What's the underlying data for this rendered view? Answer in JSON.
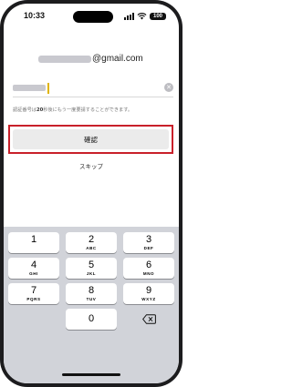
{
  "status_bar": {
    "time": "10:33",
    "battery": "100"
  },
  "account": {
    "email_domain": "@gmail.com"
  },
  "code_input": {
    "clear_icon": "clear-icon"
  },
  "hint": {
    "prefix": "認証番号は",
    "seconds": "20",
    "suffix": "秒後にもう一度要請することができます。"
  },
  "actions": {
    "confirm_label": "確認",
    "skip_label": "スキップ"
  },
  "keyboard": {
    "keys": [
      {
        "num": "1",
        "letters": ""
      },
      {
        "num": "2",
        "letters": "ABC"
      },
      {
        "num": "3",
        "letters": "DEF"
      },
      {
        "num": "4",
        "letters": "GHI"
      },
      {
        "num": "5",
        "letters": "JKL"
      },
      {
        "num": "6",
        "letters": "MNO"
      },
      {
        "num": "7",
        "letters": "PQRS"
      },
      {
        "num": "8",
        "letters": "TUV"
      },
      {
        "num": "9",
        "letters": "WXYZ"
      },
      {
        "num": "0",
        "letters": ""
      }
    ],
    "delete_icon": "backspace-icon"
  }
}
